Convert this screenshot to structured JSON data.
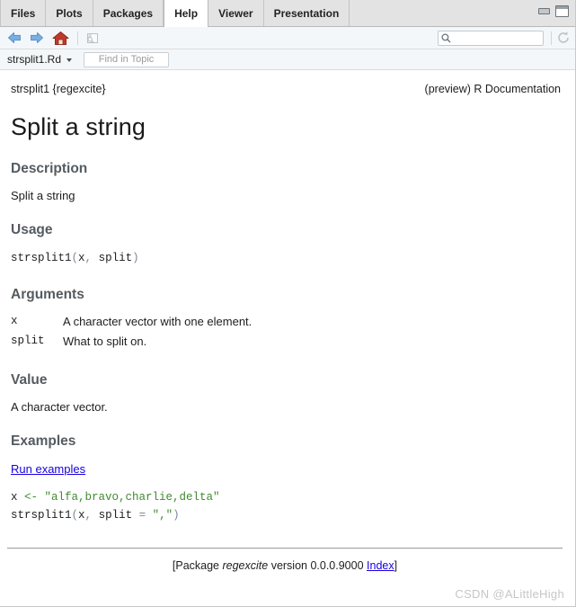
{
  "window": {
    "minimize_label": "Minimize",
    "maximize_label": "Maximize"
  },
  "tabs": [
    {
      "label": "Files",
      "active": false
    },
    {
      "label": "Plots",
      "active": false
    },
    {
      "label": "Packages",
      "active": false
    },
    {
      "label": "Help",
      "active": true
    },
    {
      "label": "Viewer",
      "active": false
    },
    {
      "label": "Presentation",
      "active": false
    }
  ],
  "toolbar": {
    "back_label": "Back",
    "forward_label": "Forward",
    "home_label": "Home",
    "print_label": "Print",
    "refresh_label": "Refresh",
    "search_placeholder": "",
    "search_value": ""
  },
  "topicbar": {
    "topic_label": "strsplit1.Rd",
    "find_placeholder": "Find in Topic",
    "find_value": ""
  },
  "doc": {
    "header_left": "strsplit1 {regexcite}",
    "header_right": "(preview) R Documentation",
    "title": "Split a string",
    "sections": {
      "description": {
        "heading": "Description",
        "text": "Split a string"
      },
      "usage": {
        "heading": "Usage",
        "code_fn": "strsplit1",
        "code_open": "(",
        "code_arg1": "x",
        "code_comma": ", ",
        "code_arg2": "split",
        "code_close": ")"
      },
      "arguments": {
        "heading": "Arguments",
        "rows": [
          {
            "name": "x",
            "desc": "A character vector with one element."
          },
          {
            "name": "split",
            "desc": "What to split on."
          }
        ]
      },
      "value": {
        "heading": "Value",
        "text": "A character vector."
      },
      "examples": {
        "heading": "Examples",
        "run_link": "Run examples",
        "line1_var": "x ",
        "line1_op": "<- ",
        "line1_str": "\"alfa,bravo,charlie,delta\"",
        "line2_fn": "strsplit1",
        "line2_open": "(",
        "line2_args": "x",
        "line2_comma": ", ",
        "line2_arg2": "split ",
        "line2_eq": "= ",
        "line2_str": "\",\"",
        "line2_close": ")"
      }
    },
    "footer": {
      "open_bracket": "[Package ",
      "package": "regexcite",
      "version_text": " version 0.0.0.9000 ",
      "index_link": "Index",
      "close_bracket": "]"
    }
  },
  "watermark": "CSDN @ALittleHigh",
  "colors": {
    "tabbar_bg": "#e3e3e3",
    "toolbar_bg": "#f4f7f9",
    "heading": "#555b60",
    "link": "#1600e0",
    "code_string": "#3f8a2e",
    "code_punct": "#7d8a99",
    "watermark": "#c6c6c6"
  }
}
